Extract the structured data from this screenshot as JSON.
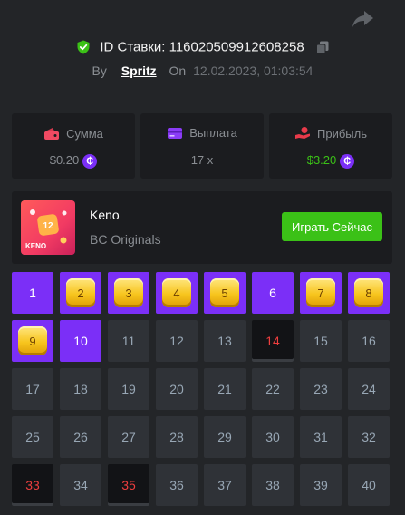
{
  "header": {
    "bet_id_label": "ID Ставки:",
    "bet_id": "116020509912608258",
    "by_label": "By",
    "username": "Spritz",
    "on_label": "On",
    "date": "12.02.2023, 01:03:54"
  },
  "stats": {
    "amount_label": "Сумма",
    "amount_value": "$0.20",
    "payout_label": "Выплата",
    "payout_value": "17 x",
    "profit_label": "Прибыль",
    "profit_value": "$3.20",
    "coin_symbol": "₵"
  },
  "game": {
    "title": "Keno",
    "provider": "BC Originals",
    "play_label": "Играть Сейчас",
    "thumb_number": "12",
    "thumb_label": "KENO"
  },
  "colors": {
    "accent_purple": "#7b2ff7",
    "green": "#3bc117",
    "miss_red": "#ed3e3e"
  },
  "grid": {
    "cells": [
      {
        "n": "1",
        "state": "selected"
      },
      {
        "n": "2",
        "state": "hit"
      },
      {
        "n": "3",
        "state": "hit"
      },
      {
        "n": "4",
        "state": "hit"
      },
      {
        "n": "5",
        "state": "hit"
      },
      {
        "n": "6",
        "state": "selected"
      },
      {
        "n": "7",
        "state": "hit"
      },
      {
        "n": "8",
        "state": "hit"
      },
      {
        "n": "9",
        "state": "hit"
      },
      {
        "n": "10",
        "state": "selected"
      },
      {
        "n": "11",
        "state": "normal"
      },
      {
        "n": "12",
        "state": "normal"
      },
      {
        "n": "13",
        "state": "normal"
      },
      {
        "n": "14",
        "state": "miss"
      },
      {
        "n": "15",
        "state": "normal"
      },
      {
        "n": "16",
        "state": "normal"
      },
      {
        "n": "17",
        "state": "normal"
      },
      {
        "n": "18",
        "state": "normal"
      },
      {
        "n": "19",
        "state": "normal"
      },
      {
        "n": "20",
        "state": "normal"
      },
      {
        "n": "21",
        "state": "normal"
      },
      {
        "n": "22",
        "state": "normal"
      },
      {
        "n": "23",
        "state": "normal"
      },
      {
        "n": "24",
        "state": "normal"
      },
      {
        "n": "25",
        "state": "normal"
      },
      {
        "n": "26",
        "state": "normal"
      },
      {
        "n": "27",
        "state": "normal"
      },
      {
        "n": "28",
        "state": "normal"
      },
      {
        "n": "29",
        "state": "normal"
      },
      {
        "n": "30",
        "state": "normal"
      },
      {
        "n": "31",
        "state": "normal"
      },
      {
        "n": "32",
        "state": "normal"
      },
      {
        "n": "33",
        "state": "miss"
      },
      {
        "n": "34",
        "state": "normal"
      },
      {
        "n": "35",
        "state": "miss"
      },
      {
        "n": "36",
        "state": "normal"
      },
      {
        "n": "37",
        "state": "normal"
      },
      {
        "n": "38",
        "state": "normal"
      },
      {
        "n": "39",
        "state": "normal"
      },
      {
        "n": "40",
        "state": "normal"
      }
    ]
  }
}
